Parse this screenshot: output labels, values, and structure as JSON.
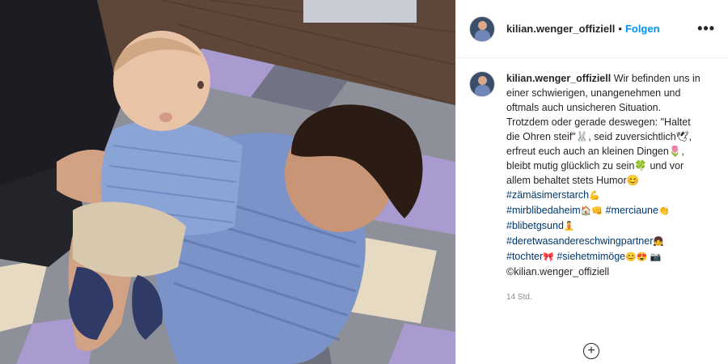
{
  "post": {
    "username": "kilian.wenger_offiziell",
    "separator": "•",
    "follow_label": "Folgen",
    "more_label": "•••",
    "caption": {
      "username": "kilian.wenger_offiziell",
      "text": "Wir befinden uns in einer schwierigen, unangenehmen und oftmals auch unsicheren Situation. Trotzdem oder gerade deswegen: \"Haltet die Ohren steif\"🐰, seid zuversichtlich🕊, erfreut euch auch an kleinen Dingen🌷, bleibt mutig glücklich zu sein🍀 und vor allem behaltet stets Humor😊",
      "hashtags": [
        {
          "tag": "#zämäsimerstarch",
          "emoji": "💪"
        },
        {
          "tag": "#mirblibedaheim",
          "emoji": "🏠👊"
        },
        {
          "tag": "#merciaune",
          "emoji": "👏"
        },
        {
          "tag": "#blibetgsund",
          "emoji": "🧘"
        },
        {
          "tag": "#deretwasandereschwingpartner",
          "emoji": "👧"
        },
        {
          "tag": "#tochter",
          "emoji": "🎀"
        },
        {
          "tag": "#siehetmimöge",
          "emoji": "😊😍 📷"
        }
      ],
      "credit": "©kilian.wenger_offiziell"
    },
    "time": "14 Std.",
    "add_comment_icon": "plus-circle-icon"
  }
}
